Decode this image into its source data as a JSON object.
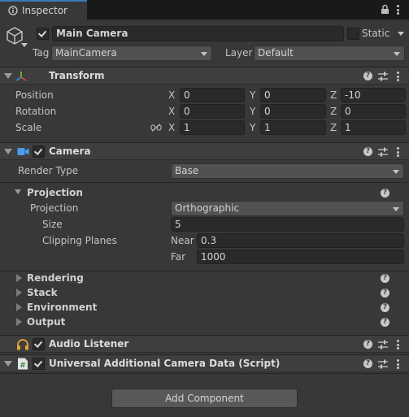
{
  "tab": {
    "title": "Inspector"
  },
  "header": {
    "object_name": "Main Camera",
    "static_label": "Static",
    "tag_label": "Tag",
    "tag_value": "MainCamera",
    "layer_label": "Layer",
    "layer_value": "Default"
  },
  "transform": {
    "title": "Transform",
    "rows": [
      {
        "label": "Position",
        "x": "0",
        "y": "0",
        "z": "-10"
      },
      {
        "label": "Rotation",
        "x": "0",
        "y": "0",
        "z": "0"
      },
      {
        "label": "Scale",
        "x": "1",
        "y": "1",
        "z": "1"
      }
    ],
    "axis": {
      "x": "X",
      "y": "Y",
      "z": "Z"
    }
  },
  "camera": {
    "title": "Camera",
    "render_type_label": "Render Type",
    "render_type_value": "Base",
    "projection_section": "Projection",
    "projection_label": "Projection",
    "projection_value": "Orthographic",
    "size_label": "Size",
    "size_value": "5",
    "clipping_label": "Clipping Planes",
    "near_label": "Near",
    "near_value": "0.3",
    "far_label": "Far",
    "far_value": "1000",
    "sections": [
      "Rendering",
      "Stack",
      "Environment",
      "Output"
    ]
  },
  "audio_listener": {
    "title": "Audio Listener"
  },
  "universal": {
    "title": "Universal Additional Camera Data (Script)"
  },
  "add_component": {
    "label": "Add Component"
  },
  "colors": {
    "background": "#383838",
    "header": "#3e3e3e",
    "field": "#2a2a2a",
    "accent": "#3a79bb"
  }
}
